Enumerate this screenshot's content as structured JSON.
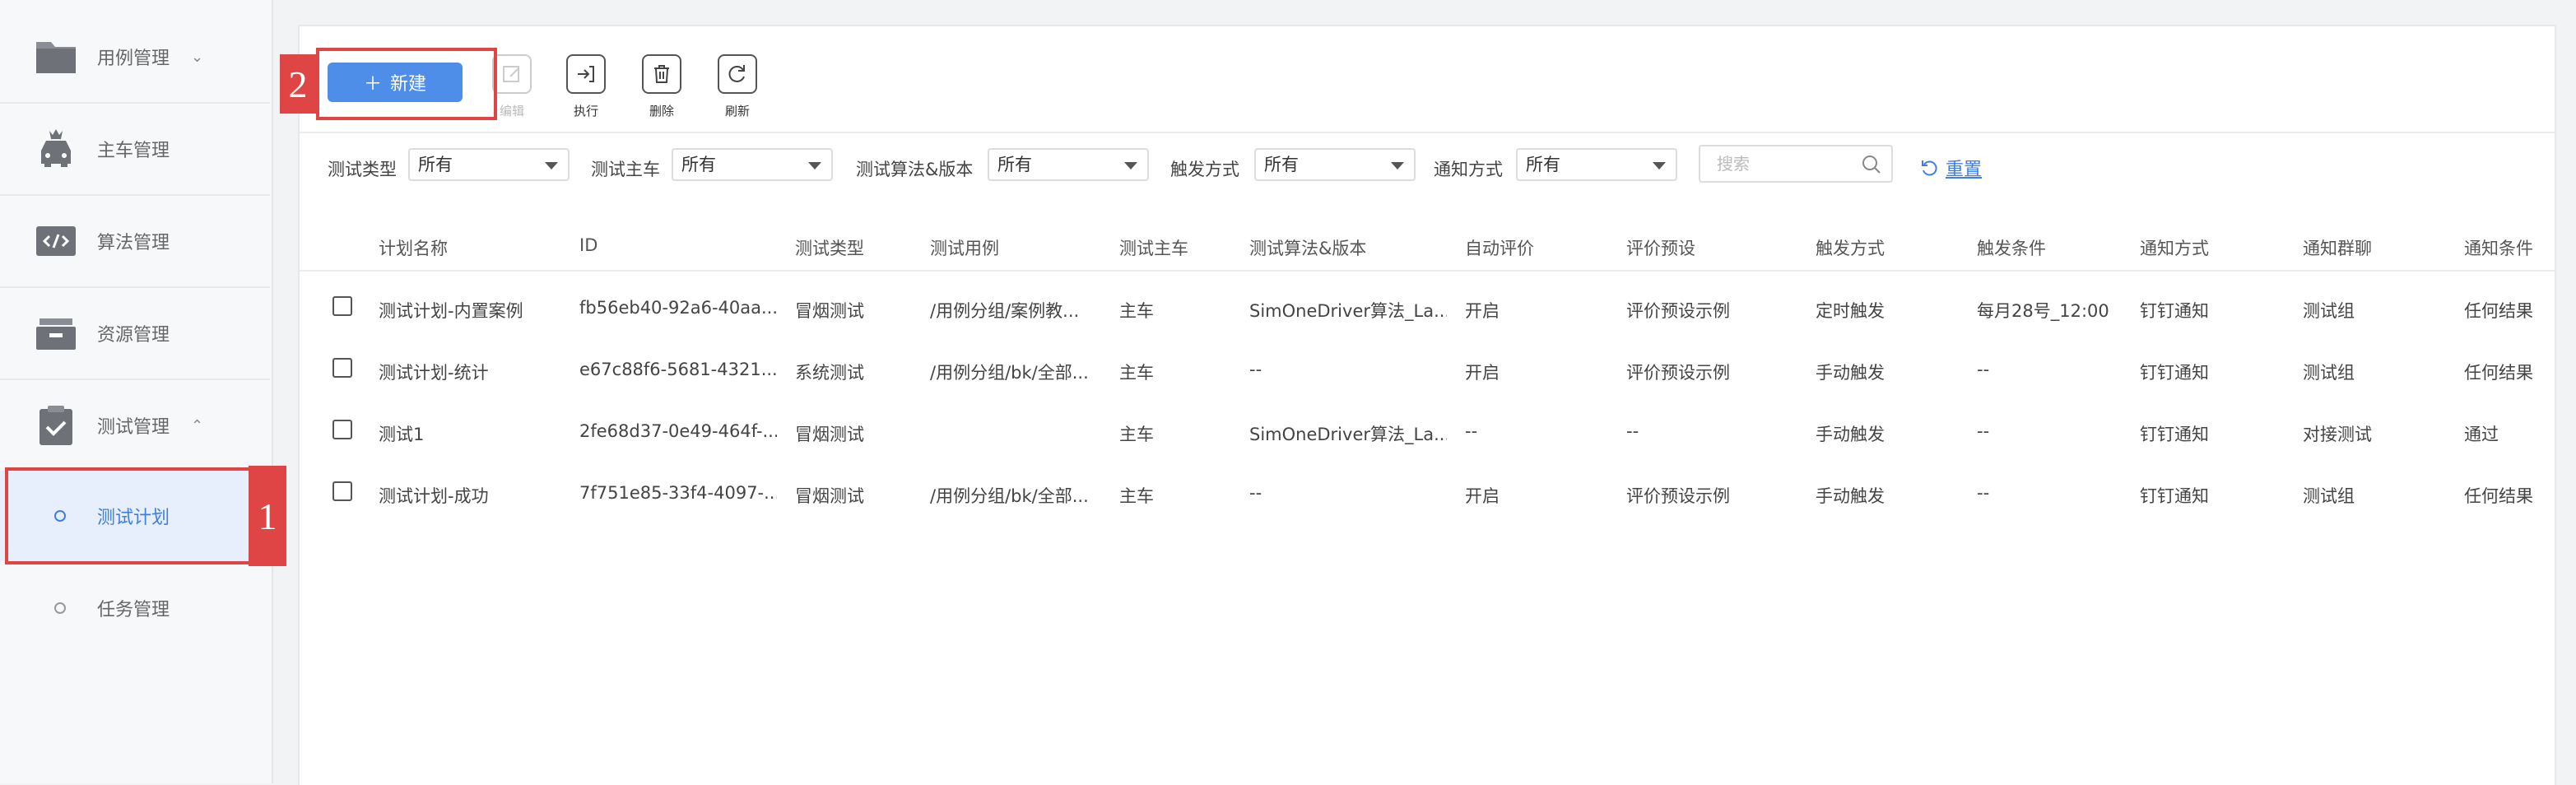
{
  "sidebar": {
    "items": [
      {
        "label": "用例管理",
        "chevron": "⌄",
        "icon": "folder-icon"
      },
      {
        "label": "主车管理",
        "icon": "car-icon"
      },
      {
        "label": "算法管理",
        "icon": "code-icon"
      },
      {
        "label": "资源管理",
        "icon": "box-icon"
      },
      {
        "label": "测试管理",
        "chevron": "⌃",
        "icon": "clipboard-check-icon"
      }
    ],
    "sub_items": [
      {
        "label": "测试计划",
        "active": true
      },
      {
        "label": "任务管理",
        "active": false
      }
    ]
  },
  "annotations": {
    "one": "1",
    "two": "2"
  },
  "toolbar": {
    "new_label": "新建",
    "new_plus": "＋",
    "tools": [
      {
        "label": "编辑",
        "icon": "edit-icon",
        "disabled": true
      },
      {
        "label": "执行",
        "icon": "execute-icon",
        "disabled": false
      },
      {
        "label": "删除",
        "icon": "delete-icon",
        "disabled": false
      },
      {
        "label": "刷新",
        "icon": "refresh-icon",
        "disabled": false
      }
    ]
  },
  "filters": {
    "test_type": {
      "label": "测试类型",
      "value": "所有"
    },
    "main_car": {
      "label": "测试主车",
      "value": "所有"
    },
    "algorithm": {
      "label": "测试算法&版本",
      "value": "所有"
    },
    "trigger": {
      "label": "触发方式",
      "value": "所有"
    },
    "notify": {
      "label": "通知方式",
      "value": "所有"
    },
    "search_placeholder": "搜索",
    "reset_label": "重置"
  },
  "table": {
    "headers": [
      "计划名称",
      "ID",
      "测试类型",
      "测试用例",
      "测试主车",
      "测试算法&版本",
      "自动评价",
      "评价预设",
      "触发方式",
      "触发条件",
      "通知方式",
      "通知群聊",
      "通知条件"
    ],
    "rows": [
      [
        "测试计划-内置案例",
        "fb56eb40-92a6-40aa...",
        "冒烟测试",
        "/用例分组/案例教...",
        "主车",
        "SimOneDriver算法_La...",
        "开启",
        "评价预设示例",
        "定时触发",
        "每月28号_12:00",
        "钉钉通知",
        "测试组",
        "任何结果"
      ],
      [
        "测试计划-统计",
        "e67c88f6-5681-4321...",
        "系统测试",
        "/用例分组/bk/全部...",
        "主车",
        "--",
        "开启",
        "评价预设示例",
        "手动触发",
        "--",
        "钉钉通知",
        "测试组",
        "任何结果"
      ],
      [
        "测试1",
        "2fe68d37-0e49-464f-...",
        "冒烟测试",
        "",
        "主车",
        "SimOneDriver算法_La...",
        "--",
        "--",
        "手动触发",
        "--",
        "钉钉通知",
        "对接测试",
        "通过"
      ],
      [
        "测试计划-成功",
        "7f751e85-33f4-4097-...",
        "冒烟测试",
        "/用例分组/bk/全部...",
        "主车",
        "--",
        "开启",
        "评价预设示例",
        "手动触发",
        "--",
        "钉钉通知",
        "测试组",
        "任何结果"
      ]
    ]
  },
  "colors": {
    "accent": "#4e8ee8",
    "annotation": "#e04545",
    "active_bg": "#e6effb"
  }
}
